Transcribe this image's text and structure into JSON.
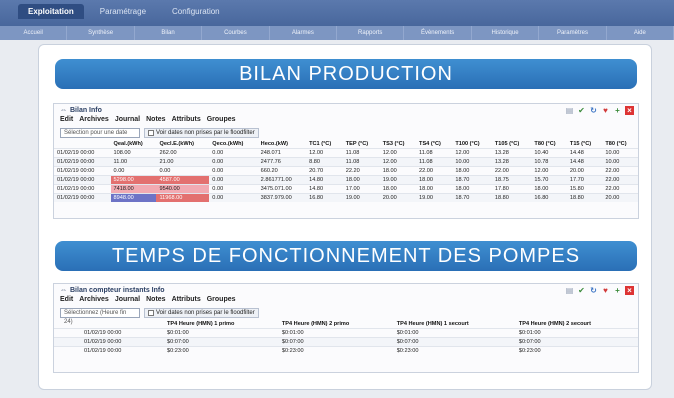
{
  "nav": {
    "tabs": [
      "Exploitation",
      "Paramétrage",
      "Configuration"
    ],
    "subnav": [
      "Accueil",
      "Synthèse",
      "Bilan",
      "Courbes",
      "Alarmes",
      "Rapports",
      "Évènements",
      "Historique",
      "Paramètres",
      "Aide"
    ]
  },
  "production": {
    "banner": "BILAN PRODUCTION",
    "panel_title": "Bilan Info",
    "menu": [
      "Edit",
      "Archives",
      "Journal",
      "Notes",
      "Attributs",
      "Groupes"
    ],
    "select_value": "Sélection pour une date",
    "checkbox_label": "Voir dates non prises par le floodfilter",
    "columns": [
      "",
      "Qeal.(kWh)",
      "Qecl.E.(kWh)",
      "Qeco.(kWh)",
      "Heco.(kW)",
      "TC1 (°C)",
      "TEP (°C)",
      "TS3 (°C)",
      "TS4 (°C)",
      "T100 (°C)",
      "T105 (°C)",
      "T80 (°C)",
      "T15 (°C)",
      "T80 (°C)"
    ],
    "rows": [
      [
        "01/02/19 00:00",
        "108.00",
        "262.00",
        "0.00",
        "248.071",
        "12.00",
        "11.08",
        "12.00",
        "11.08",
        "12.00",
        "13.28",
        "10.40",
        "14.48",
        "10.00"
      ],
      [
        "01/02/19 00:00",
        "11.00",
        "21.00",
        "0.00",
        "2477.76",
        "8.80",
        "11.08",
        "12.00",
        "11.08",
        "10.00",
        "13.28",
        "10.78",
        "14.48",
        "10.00"
      ],
      [
        "01/02/19 00:00",
        "0.00",
        "0.00",
        "0.00",
        "660.20",
        "20.70",
        "22.20",
        "18.00",
        "22.00",
        "18.00",
        "22.00",
        "12.00",
        "20.00",
        "22.00"
      ],
      [
        "01/02/19 00:00",
        "5298.00",
        "4587.00",
        "0.00",
        "2.861771.00",
        "14.80",
        "18.00",
        "19.00",
        "18.00",
        "18.70",
        "18.75",
        "15.70",
        "17.70",
        "22.00"
      ],
      [
        "01/02/19 00:00",
        "7418.00",
        "9540.00",
        "0.00",
        "3475.071.00",
        "14.80",
        "17.00",
        "18.00",
        "18.00",
        "18.00",
        "17.80",
        "18.00",
        "15.80",
        "22.00"
      ],
      [
        "01/02/19 00:00",
        "8948.00",
        "11968.00",
        "0.00",
        "3837.979.00",
        "16.80",
        "19.00",
        "20.00",
        "19.00",
        "18.70",
        "18.80",
        "16.80",
        "18.80",
        "20.00"
      ]
    ]
  },
  "pompes": {
    "banner": "TEMPS DE FONCTIONNEMENT DES POMPES",
    "panel_title": "Bilan compteur instants Info",
    "menu": [
      "Edit",
      "Archives",
      "Journal",
      "Notes",
      "Attributs",
      "Groupes"
    ],
    "select_value": "Sélectionnez (Heure fin 24)",
    "checkbox_label": "Voir dates non prises par le floodfilter",
    "columns": [
      "",
      "TP4 Heure (HMN) 1 primo",
      "TP4 Heure (HMN) 2 primo",
      "TP4 Heure (HMN) 1 secourt",
      "TP4 Heure (HMN) 2 secourt"
    ],
    "rows": [
      [
        "01/02/19 00:00",
        "$0:01:00",
        "$0:01:00",
        "$0:01:00",
        "$0:01:00"
      ],
      [
        "01/02/19 00:00",
        "$0:07:00",
        "$0:07:00",
        "$0:07:00",
        "$0:07:00"
      ],
      [
        "01/02/19 00:00",
        "$0:23:00",
        "$0:23:00",
        "$0:23:00",
        "$0:23:00"
      ]
    ]
  },
  "tool_icons": [
    "table-icon",
    "check-icon",
    "refresh-icon",
    "heart-icon",
    "add-icon",
    "close-icon"
  ],
  "colors": {
    "banner": "#2f7dc4",
    "alert_red": "#e3706f",
    "alert_pink": "#f2aab2",
    "alert_blue": "#6d73c6"
  }
}
